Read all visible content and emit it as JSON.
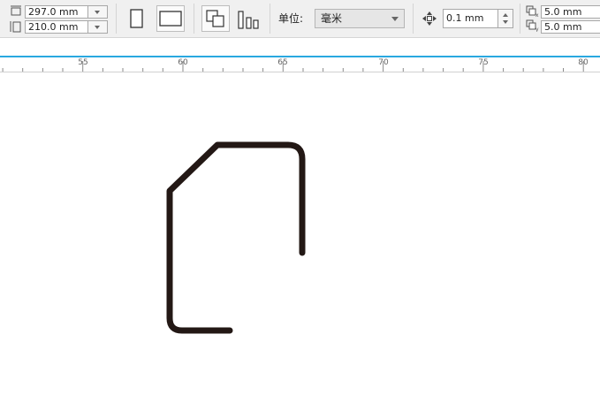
{
  "toolbar": {
    "page_width": "297.0 mm",
    "page_height": "210.0 mm",
    "units_label": "单位:",
    "units_value": "毫米",
    "nudge_value": "0.1 mm",
    "dup_x": "5.0 mm",
    "dup_y": "5.0 mm"
  },
  "ruler": {
    "labels": [
      "55",
      "60",
      "65",
      "70",
      "75",
      "80"
    ]
  },
  "colors": {
    "accent": "#29a8e0",
    "stroke": "#231815"
  }
}
